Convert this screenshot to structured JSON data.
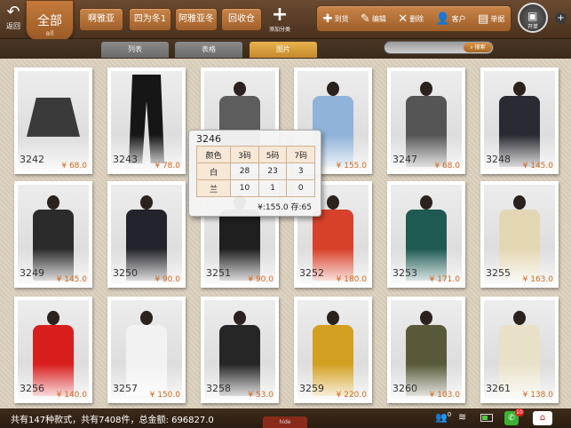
{
  "header": {
    "back": {
      "label": "返回",
      "icon": "back-arrow-icon"
    },
    "all_category": {
      "label": "全部",
      "sub": "all"
    },
    "categories": [
      "啊雅亚",
      "四为冬1",
      "阿雅亚冬",
      "回收仓"
    ],
    "add_category": {
      "label": "添加分类"
    },
    "tools": [
      {
        "label": "到货",
        "icon": "plus-icon",
        "glyph": "✚"
      },
      {
        "label": "编辑",
        "icon": "pencil-icon",
        "glyph": "✎"
      },
      {
        "label": "删除",
        "icon": "x-icon",
        "glyph": "✕"
      },
      {
        "label": "客户",
        "icon": "person-icon",
        "glyph": "👤"
      },
      {
        "label": "单据",
        "icon": "stack-icon",
        "glyph": "▤"
      }
    ],
    "open_label": "开单"
  },
  "views": {
    "tabs": [
      "列表",
      "表格",
      "图片"
    ],
    "active": "图片"
  },
  "search": {
    "placeholder": "",
    "button": "搜索"
  },
  "products": [
    {
      "code": "3242",
      "price": "¥ 68.0",
      "color": "#3a3a3a"
    },
    {
      "code": "3243",
      "price": "¥ 78.0",
      "color": "#161616"
    },
    {
      "code": "3246",
      "price": "",
      "color": "#5d5d5d"
    },
    {
      "code": "",
      "price": "¥ 155.0",
      "color": "#8fb3d9"
    },
    {
      "code": "3247",
      "price": "¥ 68.0",
      "color": "#555555"
    },
    {
      "code": "3248",
      "price": "¥ 145.0",
      "color": "#2a2a32"
    },
    {
      "code": "3249",
      "price": "¥ 145.0",
      "color": "#2b2b2b"
    },
    {
      "code": "3250",
      "price": "¥ 90.0",
      "color": "#23232b"
    },
    {
      "code": "3251",
      "price": "¥ 90.0",
      "color": "#1f1f1f"
    },
    {
      "code": "3252",
      "price": "¥ 180.0",
      "color": "#d8412a"
    },
    {
      "code": "3253",
      "price": "¥ 171.0",
      "color": "#1f5a52"
    },
    {
      "code": "3255",
      "price": "¥ 163.0",
      "color": "#e4d7b4"
    },
    {
      "code": "3256",
      "price": "¥ 140.0",
      "color": "#d91e1e"
    },
    {
      "code": "3257",
      "price": "¥ 150.0",
      "color": "#f2f2f2"
    },
    {
      "code": "3258",
      "price": "¥ 53.0",
      "color": "#262626"
    },
    {
      "code": "3259",
      "price": "¥ 220.0",
      "color": "#d4a021"
    },
    {
      "code": "3260",
      "price": "¥ 103.0",
      "color": "#5a5a3a"
    },
    {
      "code": "3261",
      "price": "¥ 138.0",
      "color": "#e9e2c9"
    }
  ],
  "popup": {
    "title": "3246",
    "headers": [
      "颜色",
      "3码",
      "5码",
      "7码"
    ],
    "rows": [
      [
        "白",
        "28",
        "23",
        "3"
      ],
      [
        "兰",
        "10",
        "1",
        "0"
      ]
    ],
    "footer": "¥:155.0  存:65"
  },
  "footer": {
    "summary": "共有147种款式，共有7408件，总金额: 696827.0",
    "hide_label": "hide",
    "person_count": "0",
    "wechat_badge": "10",
    "battery_level": 0.6
  }
}
